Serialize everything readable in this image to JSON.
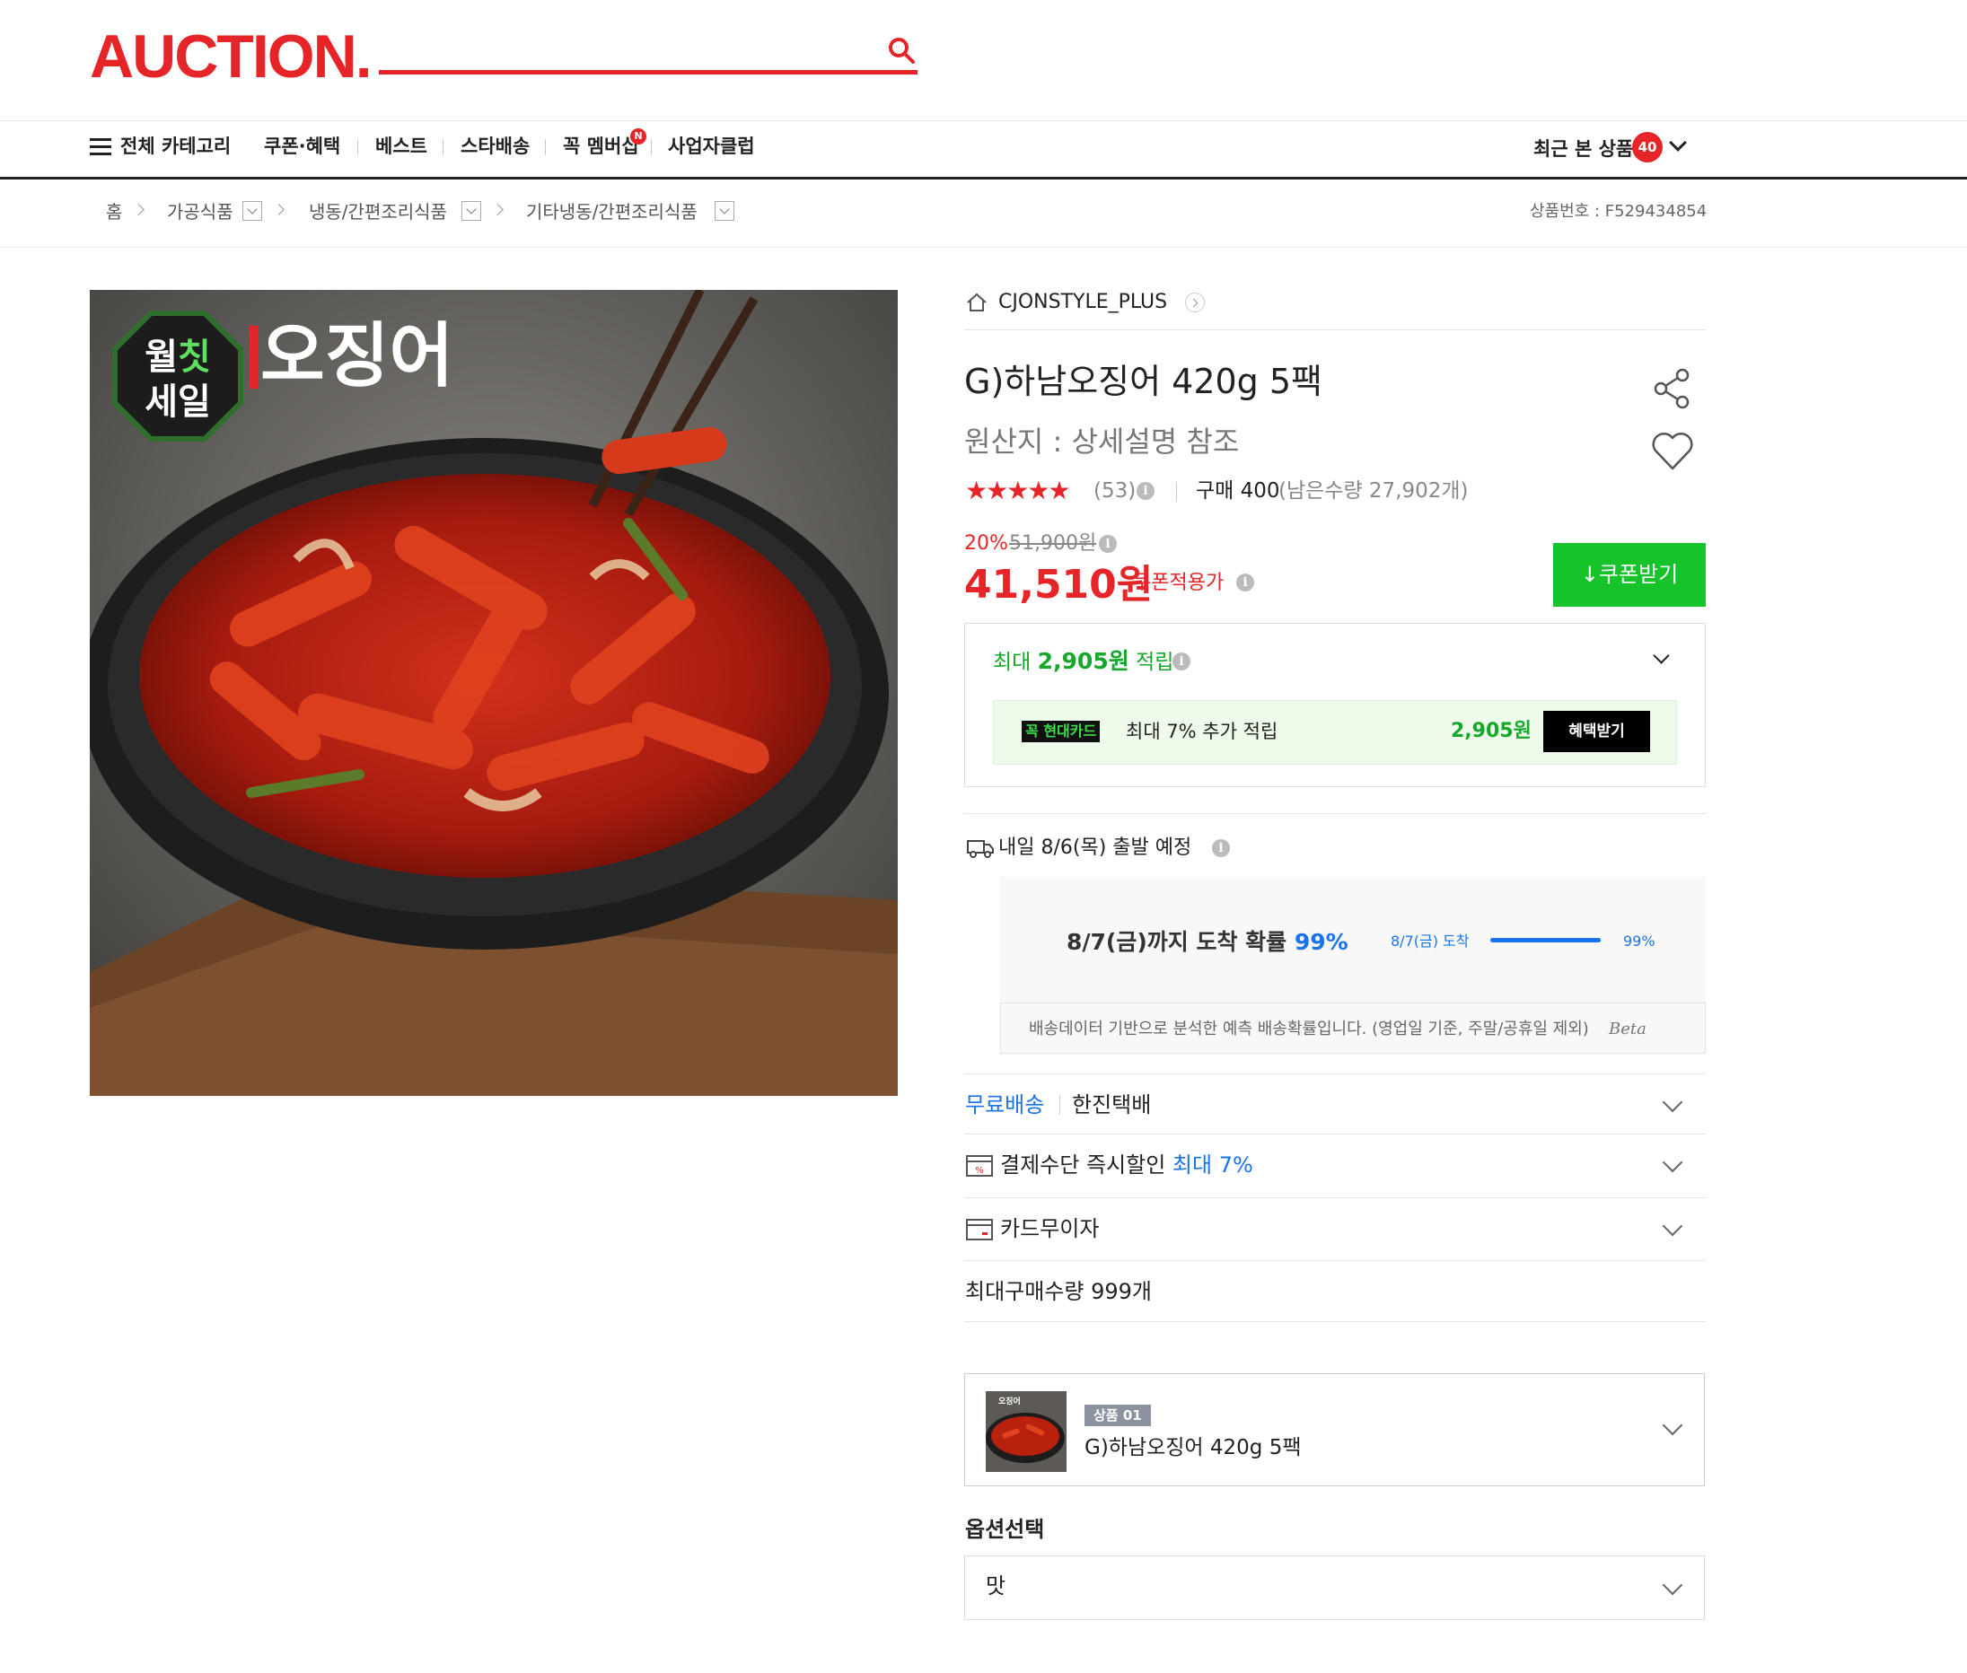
{
  "header": {
    "logo": "AUCTION.",
    "search_placeholder": ""
  },
  "nav": {
    "all_categories": "전체 카테고리",
    "items": [
      "쿠폰·혜택",
      "베스트",
      "스타배송",
      "꼭 멤버십",
      "사업자클럽"
    ],
    "membership_badge": "N",
    "recent_label": "최근 본 상품",
    "recent_count": "40"
  },
  "breadcrumb": {
    "home": "홈",
    "levels": [
      "가공식품",
      "냉동/간편조리식품",
      "기타냉동/간편조리식품"
    ],
    "product_number": "상품번호 : F529434854"
  },
  "image": {
    "badge_line1": "월",
    "badge_accent": "칫",
    "badge_line2": "세일",
    "headline": "오징어"
  },
  "product": {
    "shop": "CJONSTYLE_PLUS",
    "title": "G)하남오징어 420g 5팩",
    "origin": "원산지 : 상세설명 참조",
    "stars": "★★★★★",
    "rating": 4.5,
    "review_count": "(53)",
    "purchase": "구매 400",
    "remaining": "(남은수량 27,902개)",
    "discount_rate": "20%",
    "original_price": "51,900원",
    "price": "41,510원",
    "coupon_price_label": "쿠폰적용가",
    "coupon_button": "쿠폰받기"
  },
  "reward": {
    "prefix": "최대 ",
    "amount": "2,905원",
    "suffix": " 적립",
    "card_logo_prefix": "꼭",
    "card_logo_name": "현대카드",
    "card_text": "최대 7% 추가 적립",
    "card_amount": "2,905원",
    "card_button": "혜택받기"
  },
  "shipping": {
    "departure": "내일 8/6(목) 출발 예정",
    "prob_prefix": "8/7(금)까지 도착 확률 ",
    "prob_value": "99%",
    "bar_label": "8/7(금) 도착",
    "bar_value_label": "99%",
    "bar_value": 0.99,
    "note": "배송데이터 기반으로 분석한 예측 배송확률입니다. (영업일 기준, 주말/공휴일 제외)",
    "beta": "Beta"
  },
  "rows": {
    "free_shipping": "무료배송",
    "carrier": "한진택배",
    "payment_discount": "결제수단 즉시할인 ",
    "payment_discount_value": "최대 7%",
    "installment": "카드무이자",
    "max_qty": "최대구매수량 999개"
  },
  "selected": {
    "badge": "상품 01",
    "name": "G)하남오징어 420g 5팩",
    "thumb_headline": "오징어"
  },
  "option": {
    "label": "옵션선택",
    "value": "맛"
  },
  "colors": {
    "brand_red": "#e52528",
    "green": "#16c42a",
    "blue": "#1a73e8"
  }
}
